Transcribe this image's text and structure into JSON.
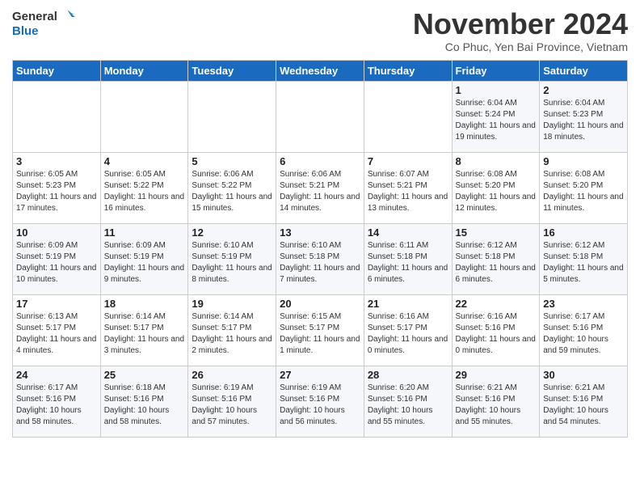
{
  "logo": {
    "line1": "General",
    "line2": "Blue"
  },
  "title": "November 2024",
  "subtitle": "Co Phuc, Yen Bai Province, Vietnam",
  "weekdays": [
    "Sunday",
    "Monday",
    "Tuesday",
    "Wednesday",
    "Thursday",
    "Friday",
    "Saturday"
  ],
  "weeks": [
    [
      {
        "day": "",
        "sunrise": "",
        "sunset": "",
        "daylight": ""
      },
      {
        "day": "",
        "sunrise": "",
        "sunset": "",
        "daylight": ""
      },
      {
        "day": "",
        "sunrise": "",
        "sunset": "",
        "daylight": ""
      },
      {
        "day": "",
        "sunrise": "",
        "sunset": "",
        "daylight": ""
      },
      {
        "day": "",
        "sunrise": "",
        "sunset": "",
        "daylight": ""
      },
      {
        "day": "1",
        "sunrise": "Sunrise: 6:04 AM",
        "sunset": "Sunset: 5:24 PM",
        "daylight": "Daylight: 11 hours and 19 minutes."
      },
      {
        "day": "2",
        "sunrise": "Sunrise: 6:04 AM",
        "sunset": "Sunset: 5:23 PM",
        "daylight": "Daylight: 11 hours and 18 minutes."
      }
    ],
    [
      {
        "day": "3",
        "sunrise": "Sunrise: 6:05 AM",
        "sunset": "Sunset: 5:23 PM",
        "daylight": "Daylight: 11 hours and 17 minutes."
      },
      {
        "day": "4",
        "sunrise": "Sunrise: 6:05 AM",
        "sunset": "Sunset: 5:22 PM",
        "daylight": "Daylight: 11 hours and 16 minutes."
      },
      {
        "day": "5",
        "sunrise": "Sunrise: 6:06 AM",
        "sunset": "Sunset: 5:22 PM",
        "daylight": "Daylight: 11 hours and 15 minutes."
      },
      {
        "day": "6",
        "sunrise": "Sunrise: 6:06 AM",
        "sunset": "Sunset: 5:21 PM",
        "daylight": "Daylight: 11 hours and 14 minutes."
      },
      {
        "day": "7",
        "sunrise": "Sunrise: 6:07 AM",
        "sunset": "Sunset: 5:21 PM",
        "daylight": "Daylight: 11 hours and 13 minutes."
      },
      {
        "day": "8",
        "sunrise": "Sunrise: 6:08 AM",
        "sunset": "Sunset: 5:20 PM",
        "daylight": "Daylight: 11 hours and 12 minutes."
      },
      {
        "day": "9",
        "sunrise": "Sunrise: 6:08 AM",
        "sunset": "Sunset: 5:20 PM",
        "daylight": "Daylight: 11 hours and 11 minutes."
      }
    ],
    [
      {
        "day": "10",
        "sunrise": "Sunrise: 6:09 AM",
        "sunset": "Sunset: 5:19 PM",
        "daylight": "Daylight: 11 hours and 10 minutes."
      },
      {
        "day": "11",
        "sunrise": "Sunrise: 6:09 AM",
        "sunset": "Sunset: 5:19 PM",
        "daylight": "Daylight: 11 hours and 9 minutes."
      },
      {
        "day": "12",
        "sunrise": "Sunrise: 6:10 AM",
        "sunset": "Sunset: 5:19 PM",
        "daylight": "Daylight: 11 hours and 8 minutes."
      },
      {
        "day": "13",
        "sunrise": "Sunrise: 6:10 AM",
        "sunset": "Sunset: 5:18 PM",
        "daylight": "Daylight: 11 hours and 7 minutes."
      },
      {
        "day": "14",
        "sunrise": "Sunrise: 6:11 AM",
        "sunset": "Sunset: 5:18 PM",
        "daylight": "Daylight: 11 hours and 6 minutes."
      },
      {
        "day": "15",
        "sunrise": "Sunrise: 6:12 AM",
        "sunset": "Sunset: 5:18 PM",
        "daylight": "Daylight: 11 hours and 6 minutes."
      },
      {
        "day": "16",
        "sunrise": "Sunrise: 6:12 AM",
        "sunset": "Sunset: 5:18 PM",
        "daylight": "Daylight: 11 hours and 5 minutes."
      }
    ],
    [
      {
        "day": "17",
        "sunrise": "Sunrise: 6:13 AM",
        "sunset": "Sunset: 5:17 PM",
        "daylight": "Daylight: 11 hours and 4 minutes."
      },
      {
        "day": "18",
        "sunrise": "Sunrise: 6:14 AM",
        "sunset": "Sunset: 5:17 PM",
        "daylight": "Daylight: 11 hours and 3 minutes."
      },
      {
        "day": "19",
        "sunrise": "Sunrise: 6:14 AM",
        "sunset": "Sunset: 5:17 PM",
        "daylight": "Daylight: 11 hours and 2 minutes."
      },
      {
        "day": "20",
        "sunrise": "Sunrise: 6:15 AM",
        "sunset": "Sunset: 5:17 PM",
        "daylight": "Daylight: 11 hours and 1 minute."
      },
      {
        "day": "21",
        "sunrise": "Sunrise: 6:16 AM",
        "sunset": "Sunset: 5:17 PM",
        "daylight": "Daylight: 11 hours and 0 minutes."
      },
      {
        "day": "22",
        "sunrise": "Sunrise: 6:16 AM",
        "sunset": "Sunset: 5:16 PM",
        "daylight": "Daylight: 11 hours and 0 minutes."
      },
      {
        "day": "23",
        "sunrise": "Sunrise: 6:17 AM",
        "sunset": "Sunset: 5:16 PM",
        "daylight": "Daylight: 10 hours and 59 minutes."
      }
    ],
    [
      {
        "day": "24",
        "sunrise": "Sunrise: 6:17 AM",
        "sunset": "Sunset: 5:16 PM",
        "daylight": "Daylight: 10 hours and 58 minutes."
      },
      {
        "day": "25",
        "sunrise": "Sunrise: 6:18 AM",
        "sunset": "Sunset: 5:16 PM",
        "daylight": "Daylight: 10 hours and 58 minutes."
      },
      {
        "day": "26",
        "sunrise": "Sunrise: 6:19 AM",
        "sunset": "Sunset: 5:16 PM",
        "daylight": "Daylight: 10 hours and 57 minutes."
      },
      {
        "day": "27",
        "sunrise": "Sunrise: 6:19 AM",
        "sunset": "Sunset: 5:16 PM",
        "daylight": "Daylight: 10 hours and 56 minutes."
      },
      {
        "day": "28",
        "sunrise": "Sunrise: 6:20 AM",
        "sunset": "Sunset: 5:16 PM",
        "daylight": "Daylight: 10 hours and 55 minutes."
      },
      {
        "day": "29",
        "sunrise": "Sunrise: 6:21 AM",
        "sunset": "Sunset: 5:16 PM",
        "daylight": "Daylight: 10 hours and 55 minutes."
      },
      {
        "day": "30",
        "sunrise": "Sunrise: 6:21 AM",
        "sunset": "Sunset: 5:16 PM",
        "daylight": "Daylight: 10 hours and 54 minutes."
      }
    ]
  ]
}
